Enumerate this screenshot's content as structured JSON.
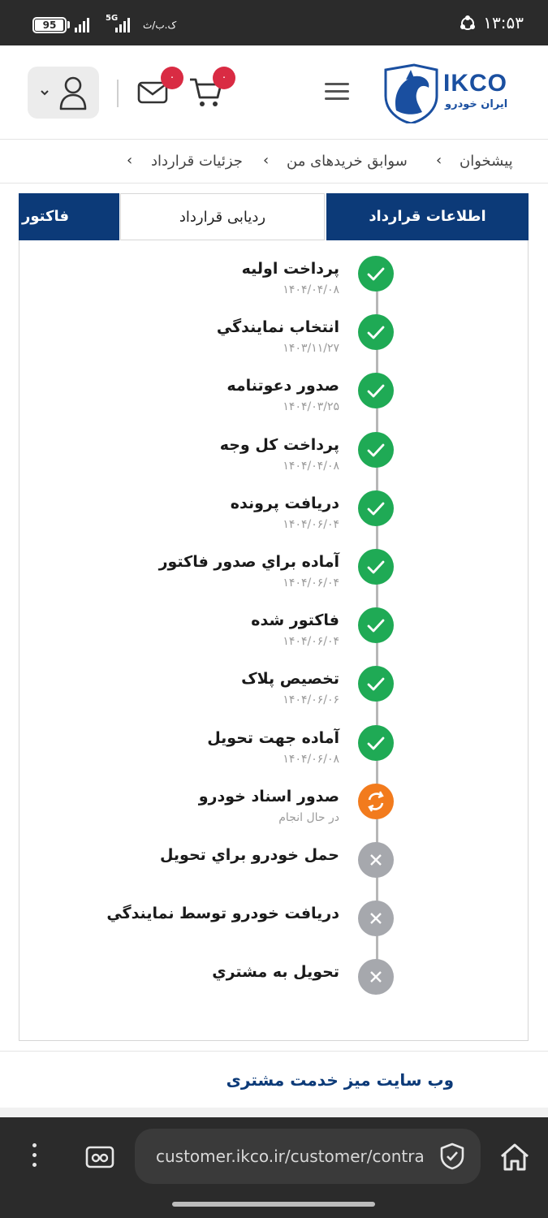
{
  "status_bar": {
    "time": "۱۳:۵۳",
    "battery": "95",
    "network_type": "5G",
    "data_speed": "ک.ب/ث"
  },
  "header": {
    "brand_latin": "IKCO",
    "brand_persian": "ایران خودرو",
    "cart_count": "۰",
    "mail_count": "۰",
    "brand_color": "#0c3a78",
    "badge_color": "#d92b43"
  },
  "breadcrumb": {
    "items": [
      "پیشخوان",
      "سوابق خریدهای من",
      "جزئیات قرارداد"
    ]
  },
  "tabs": [
    {
      "label": "اطلاعات قرارداد",
      "state": "active"
    },
    {
      "label": "ردیابی قرارداد",
      "state": "selected"
    },
    {
      "label": "فاکتور",
      "state": "active"
    }
  ],
  "timeline": {
    "steps": [
      {
        "title": "پرداخت اولیه",
        "date": "۱۴۰۴/۰۴/۰۸",
        "status": "done"
      },
      {
        "title": "انتخاب نمایندگي",
        "date": "۱۴۰۳/۱۱/۲۷",
        "status": "done"
      },
      {
        "title": "صدور دعوتنامه",
        "date": "۱۴۰۴/۰۳/۲۵",
        "status": "done"
      },
      {
        "title": "پرداخت کل وجه",
        "date": "۱۴۰۴/۰۴/۰۸",
        "status": "done"
      },
      {
        "title": "دریافت پرونده",
        "date": "۱۴۰۴/۰۶/۰۴",
        "status": "done"
      },
      {
        "title": "آماده براي صدور فاكتور",
        "date": "۱۴۰۴/۰۶/۰۴",
        "status": "done"
      },
      {
        "title": "فاكتور شده",
        "date": "۱۴۰۴/۰۶/۰۴",
        "status": "done"
      },
      {
        "title": "تخصیص پلاک",
        "date": "۱۴۰۴/۰۶/۰۶",
        "status": "done"
      },
      {
        "title": "آماده جهت تحویل",
        "date": "۱۴۰۴/۰۶/۰۸",
        "status": "done"
      },
      {
        "title": "صدور اسناد خودرو",
        "date": "در حال انجام",
        "status": "in-progress"
      },
      {
        "title": "حمل خودرو براي تحويل",
        "date": "",
        "status": "pending"
      },
      {
        "title": "دريافت خودرو توسط نمايندگي",
        "date": "",
        "status": "pending"
      },
      {
        "title": "تحويل به مشتري",
        "date": "",
        "status": "pending"
      }
    ]
  },
  "footer": {
    "link": "وب سایت میز خدمت مشتری"
  },
  "browser": {
    "url": "customer.ikco.ir/customer/contra"
  }
}
